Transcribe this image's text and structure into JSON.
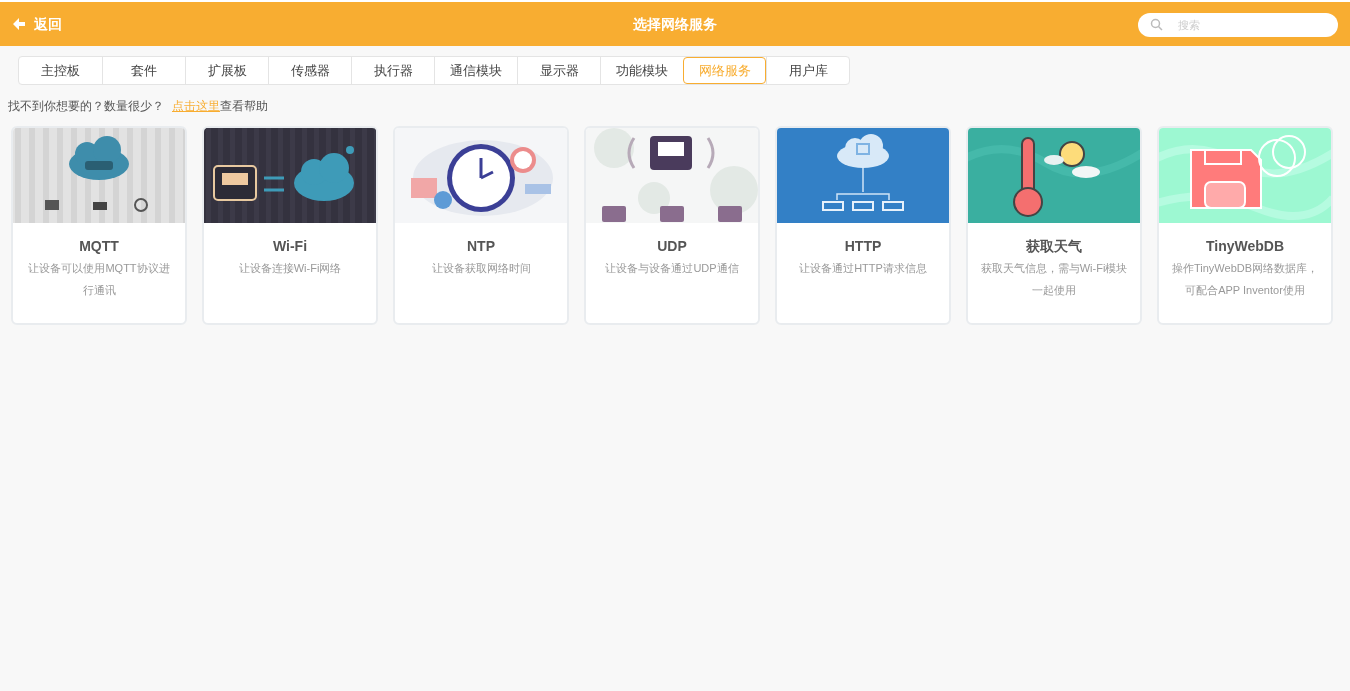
{
  "header": {
    "back": "返回",
    "title": "选择网络服务",
    "search": {
      "placeholder": "搜索"
    }
  },
  "tabs": [
    {
      "label": "主控板",
      "selected": false
    },
    {
      "label": "套件",
      "selected": false
    },
    {
      "label": "扩展板",
      "selected": false
    },
    {
      "label": "传感器",
      "selected": false
    },
    {
      "label": "执行器",
      "selected": false
    },
    {
      "label": "通信模块",
      "selected": false
    },
    {
      "label": "显示器",
      "selected": false
    },
    {
      "label": "功能模块",
      "selected": false
    },
    {
      "label": "网络服务",
      "selected": true
    },
    {
      "label": "用户库",
      "selected": false
    }
  ],
  "help": {
    "text": "找不到你想要的？数量很少？",
    "link": "点击这里",
    "after": "查看帮助"
  },
  "cards": [
    {
      "title": "MQTT",
      "description": "让设备可以使用MQTT协议进行通讯"
    },
    {
      "title": "Wi-Fi",
      "description": "让设备连接Wi-Fi网络"
    },
    {
      "title": "NTP",
      "description": "让设备获取网络时间"
    },
    {
      "title": "UDP",
      "description": "让设备与设备通过UDP通信"
    },
    {
      "title": "HTTP",
      "description": "让设备通过HTTP请求信息"
    },
    {
      "title": "获取天气",
      "description": "获取天气信息，需与Wi-Fi模块一起使用"
    },
    {
      "title": "TinyWebDB",
      "description": "操作TinyWebDB网络数据库，可配合APP Inventor使用"
    }
  ]
}
